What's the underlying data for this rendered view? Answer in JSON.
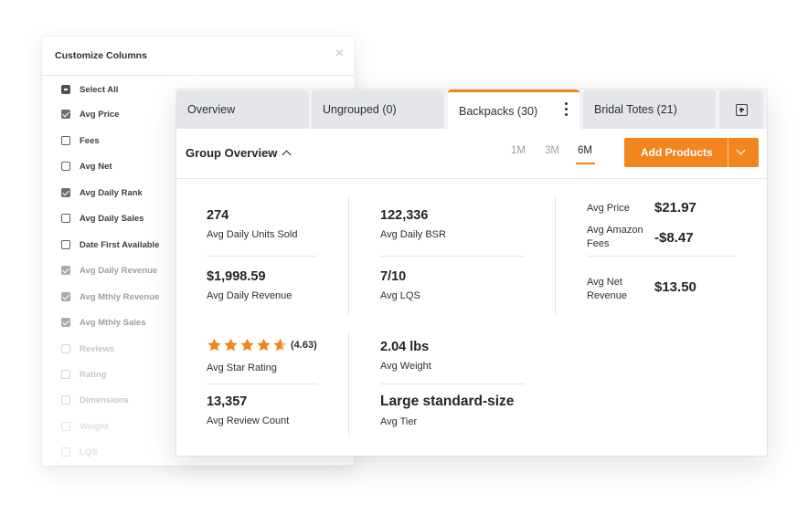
{
  "customize_columns": {
    "title": "Customize Columns",
    "close_icon": "×",
    "items": [
      {
        "label": "Select All",
        "state": "partial"
      },
      {
        "label": "Avg Price",
        "state": "checked"
      },
      {
        "label": "Fees",
        "state": "unchecked"
      },
      {
        "label": "Avg Net",
        "state": "unchecked"
      },
      {
        "label": "Avg Daily Rank",
        "state": "checked"
      },
      {
        "label": "Avg Daily Sales",
        "state": "unchecked"
      },
      {
        "label": "Date First Available",
        "state": "unchecked"
      },
      {
        "label": "Avg Daily Revenue",
        "state": "checked"
      },
      {
        "label": "Avg Mthly Revenue",
        "state": "checked"
      },
      {
        "label": "Avg Mthly Sales",
        "state": "checked"
      },
      {
        "label": "Reviews",
        "state": "unchecked"
      },
      {
        "label": "Rating",
        "state": "unchecked"
      },
      {
        "label": "Dimensions",
        "state": "unchecked"
      },
      {
        "label": "Weight",
        "state": "unchecked"
      },
      {
        "label": "LQS",
        "state": "unchecked"
      }
    ]
  },
  "tabs": [
    {
      "label": "Overview"
    },
    {
      "label": "Ungrouped (0)"
    },
    {
      "label": "Backpacks (30)",
      "active": true
    },
    {
      "label": "Bridal Totes (21)"
    }
  ],
  "toolbar": {
    "group_title": "Group Overview",
    "ranges": [
      "1M",
      "3M",
      "6M"
    ],
    "active_range": "6M",
    "add_button": "Add Products"
  },
  "metrics": {
    "units_sold": {
      "value": "274",
      "label": "Avg Daily Units Sold"
    },
    "bsr": {
      "value": "122,336",
      "label": "Avg Daily BSR"
    },
    "revenue": {
      "value": "$1,998.59",
      "label": "Avg Daily Revenue"
    },
    "lqs": {
      "value": "7/10",
      "label": "Avg LQS"
    },
    "star_rating": {
      "value": "(4.63)",
      "label": "Avg Star Rating",
      "stars": 4.63
    },
    "weight": {
      "value": "2.04 lbs",
      "label": "Avg Weight"
    },
    "review_count": {
      "value": "13,357",
      "label": "Avg Review Count"
    },
    "tier": {
      "value": "Large standard-size",
      "label": "Avg Tier"
    }
  },
  "pricing": {
    "price": {
      "label": "Avg Price",
      "value": "$21.97"
    },
    "fees": {
      "label_line1": "Avg Amazon",
      "label_line2": "Fees",
      "value": "-$8.47"
    },
    "net": {
      "label_line1": "Avg Net",
      "label_line2": "Revenue",
      "value": "$13.50"
    }
  },
  "colors": {
    "accent": "#f2851d",
    "star": "#f2851d"
  }
}
